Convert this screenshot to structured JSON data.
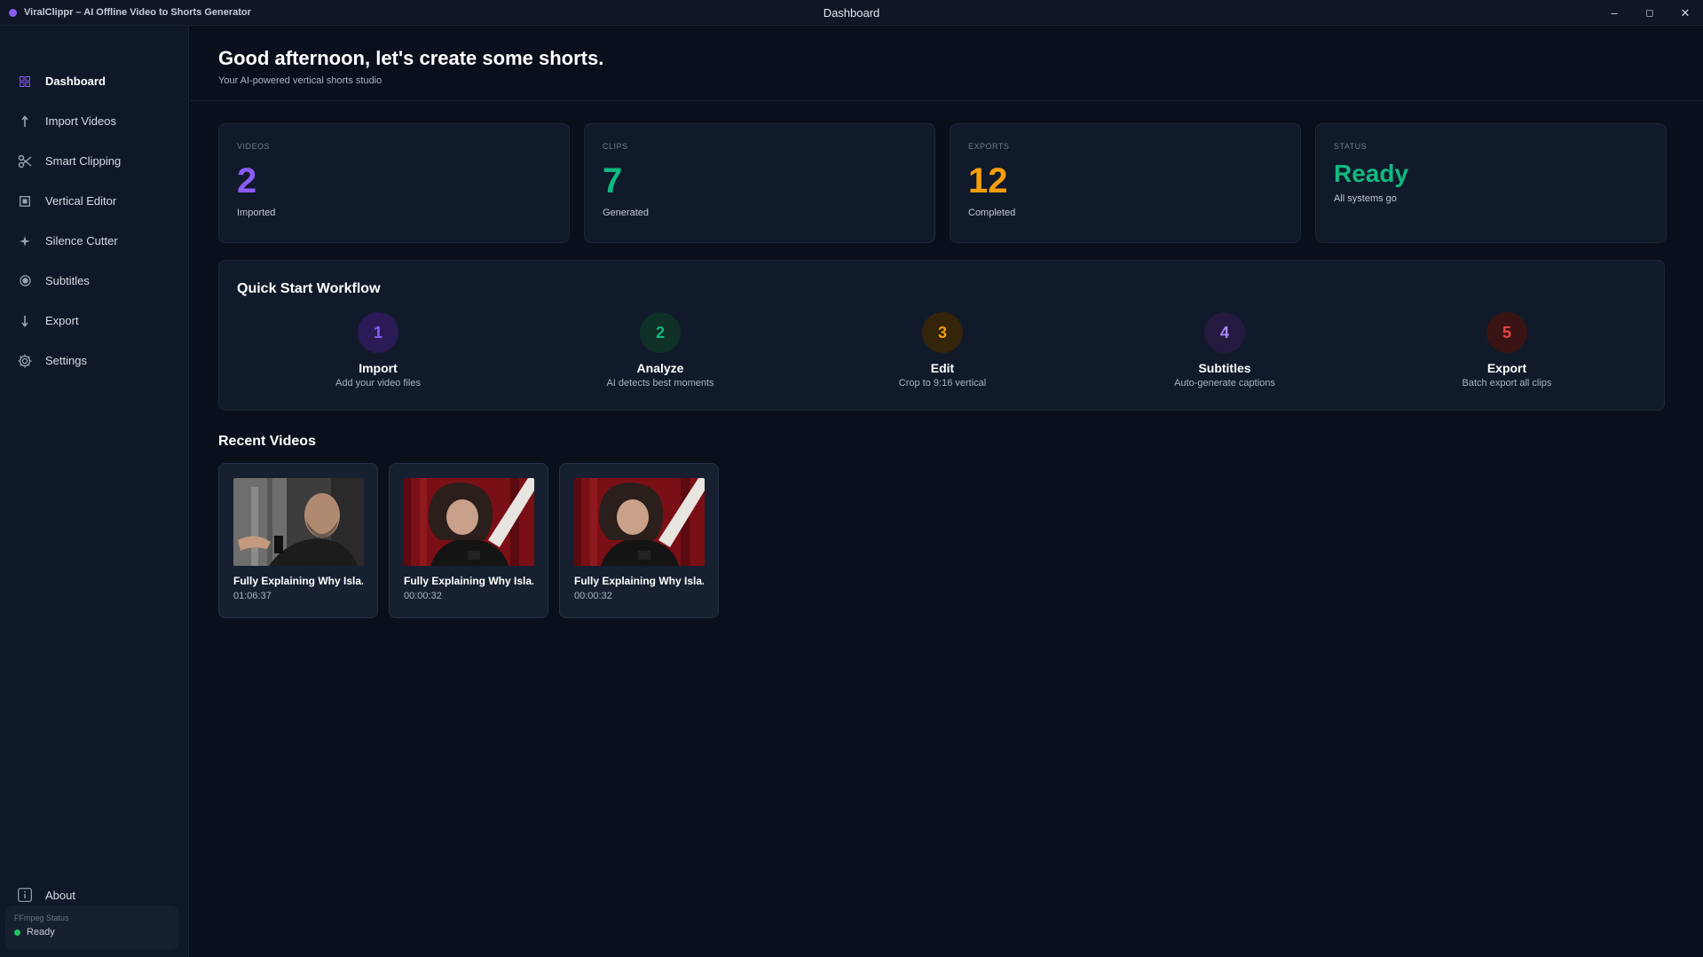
{
  "app": {
    "title": "ViralClippr – AI Offline Video to Shorts Generator",
    "window_title": "Dashboard",
    "controls": {
      "minimize": "–",
      "maximize": "◻",
      "close": "✕"
    }
  },
  "sidebar": {
    "items": [
      {
        "label": "Dashboard",
        "icon": "grid-icon"
      },
      {
        "label": "Import Videos",
        "icon": "upload-icon"
      },
      {
        "label": "Smart Clipping",
        "icon": "scissors-icon"
      },
      {
        "label": "Vertical Editor",
        "icon": "square-icon"
      },
      {
        "label": "Silence Cutter",
        "icon": "sparkle-icon"
      },
      {
        "label": "Subtitles",
        "icon": "circle-dot-icon"
      },
      {
        "label": "Export",
        "icon": "download-icon"
      },
      {
        "label": "Settings",
        "icon": "gear-icon"
      }
    ],
    "about": "About",
    "ffmpeg": {
      "label": "FFmpeg Status",
      "status": "Ready"
    }
  },
  "header": {
    "greeting": "Good afternoon, let's create some shorts.",
    "subtitle": "Your AI-powered vertical shorts studio"
  },
  "stats": [
    {
      "label": "VIDEOS",
      "value": "2",
      "sub": "Imported",
      "color": "#8b5cf6"
    },
    {
      "label": "CLIPS",
      "value": "7",
      "sub": "Generated",
      "color": "#10b981"
    },
    {
      "label": "EXPORTS",
      "value": "12",
      "sub": "Completed",
      "color": "#f59e0b"
    },
    {
      "label": "STATUS",
      "value": "Ready",
      "sub": "All systems go",
      "color": "#10b981"
    }
  ],
  "workflow": {
    "title": "Quick Start Workflow",
    "steps": [
      {
        "num": "1",
        "title": "Import",
        "desc": "Add your video files",
        "color": "#8b5cf6",
        "bg": "#2a1a55"
      },
      {
        "num": "2",
        "title": "Analyze",
        "desc": "AI detects best moments",
        "color": "#10b981",
        "bg": "#0f3026"
      },
      {
        "num": "3",
        "title": "Edit",
        "desc": "Crop to 9:16 vertical",
        "color": "#f59e0b",
        "bg": "#33240a"
      },
      {
        "num": "4",
        "title": "Subtitles",
        "desc": "Auto-generate captions",
        "color": "#a78bfa",
        "bg": "#26193f"
      },
      {
        "num": "5",
        "title": "Export",
        "desc": "Batch export all clips",
        "color": "#ef4444",
        "bg": "#3a1414"
      }
    ]
  },
  "recent": {
    "title": "Recent Videos",
    "videos": [
      {
        "title": "Fully Explaining Why Isla...",
        "duration": "01:06:37"
      },
      {
        "title": "Fully Explaining Why Isla...",
        "duration": "00:00:32"
      },
      {
        "title": "Fully Explaining Why Isla...",
        "duration": "00:00:32"
      }
    ]
  }
}
